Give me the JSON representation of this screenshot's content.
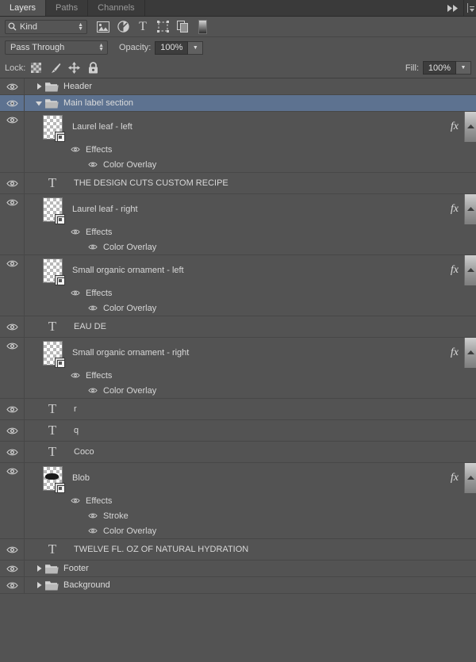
{
  "panel": {
    "tabs": [
      {
        "label": "Layers",
        "active": true
      },
      {
        "label": "Paths",
        "active": false
      },
      {
        "label": "Channels",
        "active": false
      }
    ],
    "collapse_icon": "double-chevron-right-icon",
    "menu_icon": "panel-menu-icon"
  },
  "filter": {
    "kind_label": "Kind",
    "search_icon": "magnifier-icon",
    "icons": [
      "pixel-layer-filter-icon",
      "adjustment-layer-filter-icon",
      "type-layer-filter-icon",
      "shape-layer-filter-icon",
      "smart-object-filter-icon",
      "filter-toggle-icon"
    ]
  },
  "blend": {
    "mode": "Pass Through",
    "opacity_label": "Opacity:",
    "opacity_value": "100%",
    "fill_label": "Fill:",
    "fill_value": "100%"
  },
  "lock": {
    "label": "Lock:",
    "icons": [
      "lock-transparent-pixels-icon",
      "lock-image-pixels-icon",
      "lock-position-icon",
      "lock-all-icon"
    ]
  },
  "layers": [
    {
      "name": "Header",
      "type": "group",
      "visible": true,
      "expanded": false,
      "selected": false
    },
    {
      "name": "Main label section",
      "type": "group",
      "visible": true,
      "expanded": true,
      "selected": true
    },
    {
      "name": "Laurel leaf - left",
      "type": "smart-object",
      "visible": true,
      "selected": false,
      "has_fx": true,
      "effects_label": "Effects",
      "effects": [
        "Color Overlay"
      ]
    },
    {
      "name": "THE DESIGN CUTS CUSTOM RECIPE",
      "type": "text",
      "visible": true,
      "selected": false,
      "has_fx": false,
      "effects": []
    },
    {
      "name": "Laurel leaf - right",
      "type": "smart-object",
      "visible": true,
      "selected": false,
      "has_fx": true,
      "effects_label": "Effects",
      "effects": [
        "Color Overlay"
      ]
    },
    {
      "name": "Small organic ornament - left",
      "type": "smart-object",
      "visible": true,
      "selected": false,
      "has_fx": true,
      "effects_label": "Effects",
      "effects": [
        "Color Overlay"
      ]
    },
    {
      "name": "EAU DE",
      "type": "text",
      "visible": true,
      "selected": false,
      "has_fx": false,
      "effects": []
    },
    {
      "name": "Small organic ornament - right",
      "type": "smart-object",
      "visible": true,
      "selected": false,
      "has_fx": true,
      "effects_label": "Effects",
      "effects": [
        "Color Overlay"
      ]
    },
    {
      "name": "r",
      "type": "text",
      "visible": true,
      "selected": false,
      "has_fx": false,
      "effects": []
    },
    {
      "name": "q",
      "type": "text",
      "visible": true,
      "selected": false,
      "has_fx": false,
      "effects": []
    },
    {
      "name": "Coco",
      "type": "text",
      "visible": true,
      "selected": false,
      "has_fx": false,
      "effects": []
    },
    {
      "name": "Blob",
      "type": "smart-object-blob",
      "visible": true,
      "selected": false,
      "has_fx": true,
      "effects_label": "Effects",
      "effects": [
        "Stroke",
        "Color Overlay"
      ]
    },
    {
      "name": "TWELVE FL. OZ OF NATURAL HYDRATION",
      "type": "text",
      "visible": true,
      "selected": false,
      "has_fx": false,
      "effects": []
    },
    {
      "name": "Footer",
      "type": "group",
      "visible": true,
      "expanded": false,
      "selected": false
    },
    {
      "name": "Background",
      "type": "group",
      "visible": true,
      "expanded": false,
      "selected": false
    }
  ],
  "colors": {
    "panel_bg": "#535353",
    "tab_bg": "#3a3a3a",
    "selected_row": "#5d7290",
    "text": "#d8d8d8",
    "divider": "#474747"
  }
}
